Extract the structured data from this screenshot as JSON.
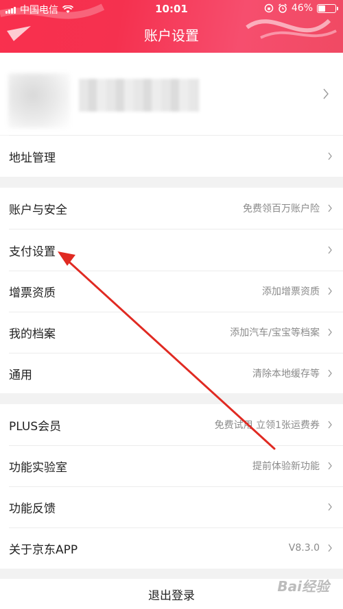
{
  "status_bar": {
    "carrier": "中国电信",
    "time": "10:01",
    "battery_percent": "46%",
    "battery_level": 0.46
  },
  "header": {
    "title": "账户设置"
  },
  "rows": {
    "address": {
      "label": "地址管理"
    },
    "security": {
      "label": "账户与安全",
      "hint": "免费领百万账户险"
    },
    "payment": {
      "label": "支付设置"
    },
    "invoice": {
      "label": "增票资质",
      "hint": "添加增票资质"
    },
    "profile": {
      "label": "我的档案",
      "hint": "添加汽车/宝宝等档案"
    },
    "general": {
      "label": "通用",
      "hint": "清除本地缓存等"
    },
    "plus": {
      "label": "PLUS会员",
      "hint": "免费试用 立领1张运费券"
    },
    "lab": {
      "label": "功能实验室",
      "hint": "提前体验新功能"
    },
    "feedback": {
      "label": "功能反馈"
    },
    "about": {
      "label": "关于京东APP",
      "hint": "V8.3.0"
    }
  },
  "logout": {
    "label": "退出登录"
  },
  "colors": {
    "header_red": "#f5314f",
    "annotation_arrow": "#e02a22",
    "hint_gray": "#8a8a8a"
  }
}
